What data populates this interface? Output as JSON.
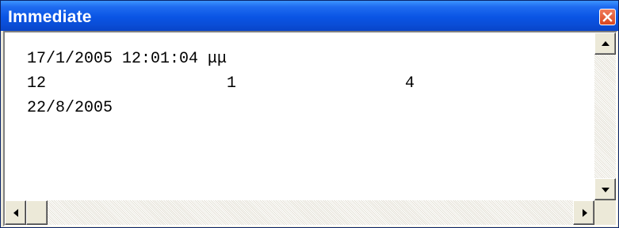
{
  "window": {
    "title": "Immediate",
    "close_icon": "close-x-icon"
  },
  "output_lines": [
    {
      "cols": [
        "17/1/2005 12:01:04 μμ"
      ]
    },
    {
      "cols": [
        "12",
        "1",
        "4"
      ]
    },
    {
      "cols": [
        "22/8/2005"
      ]
    }
  ],
  "scrollbars": {
    "up_icon": "arrow-up-icon",
    "down_icon": "arrow-down-icon",
    "left_icon": "arrow-left-icon",
    "right_icon": "arrow-right-icon"
  },
  "colors": {
    "title_bar": "#0a54e4",
    "close_button": "#d9461f",
    "window_face": "#ece9d8"
  }
}
